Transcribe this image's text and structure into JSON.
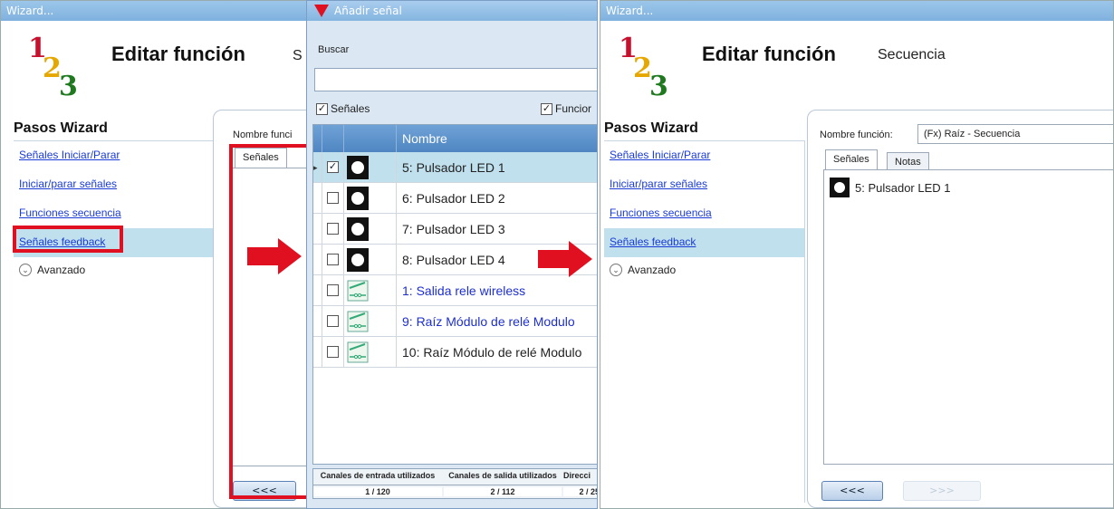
{
  "left": {
    "title": "Wizard...",
    "logo": [
      "1",
      "2",
      "3"
    ],
    "header_title": "Editar función",
    "header_sub": "S",
    "steps_title": "Pasos Wizard",
    "steps": [
      "Señales Iniciar/Parar",
      "Iniciar/parar señales",
      "Funciones secuencia",
      "Señales feedback"
    ],
    "advanced": "Avanzado",
    "fn_label": "Nombre funci",
    "tab_signals": "Señales",
    "back_btn": "<<<"
  },
  "dialog": {
    "title": "Añadir señal",
    "search_label": "Buscar",
    "search_value": "",
    "filter_signals": "Señales",
    "filter_functions": "Funcior",
    "col_name": "Nombre",
    "rows": [
      {
        "name": "5: Pulsador LED 1",
        "checked": true,
        "type": "led",
        "blue": false
      },
      {
        "name": "6: Pulsador LED 2",
        "checked": false,
        "type": "led",
        "blue": false
      },
      {
        "name": "7: Pulsador LED 3",
        "checked": false,
        "type": "led",
        "blue": false
      },
      {
        "name": "8: Pulsador LED 4",
        "checked": false,
        "type": "led",
        "blue": false
      },
      {
        "name": "1: Salida rele wireless",
        "checked": false,
        "type": "relay",
        "blue": true
      },
      {
        "name": "9: Raíz Módulo de relé Modulo",
        "checked": false,
        "type": "relay",
        "blue": true
      },
      {
        "name": "10: Raíz Módulo de relé Modulo",
        "checked": false,
        "type": "relay",
        "blue": false
      }
    ],
    "footer_headers": [
      "Canales de entrada utilizados",
      "Canales de salida utilizados",
      "Direcci"
    ],
    "footer_values": [
      "1 / 120",
      "2 / 112",
      "2 / 25"
    ]
  },
  "right": {
    "title": "Wizard...",
    "logo": [
      "1",
      "2",
      "3"
    ],
    "header_title": "Editar función",
    "header_sub": "Secuencia",
    "steps_title": "Pasos Wizard",
    "steps": [
      "Señales Iniciar/Parar",
      "Iniciar/parar señales",
      "Funciones secuencia",
      "Señales feedback"
    ],
    "advanced": "Avanzado",
    "fn_label": "Nombre función:",
    "fn_value": "(Fx) Raíz - Secuencia",
    "tab_signals": "Señales",
    "tab_notes": "Notas",
    "list_item": "5: Pulsador LED 1",
    "back_btn": "<<<",
    "next_btn": ">>>"
  },
  "colors": {
    "accent_red": "#e01020",
    "selection": "#bfe0ec",
    "title_bar": "#7fb1de",
    "link": "#1a3bd6"
  }
}
